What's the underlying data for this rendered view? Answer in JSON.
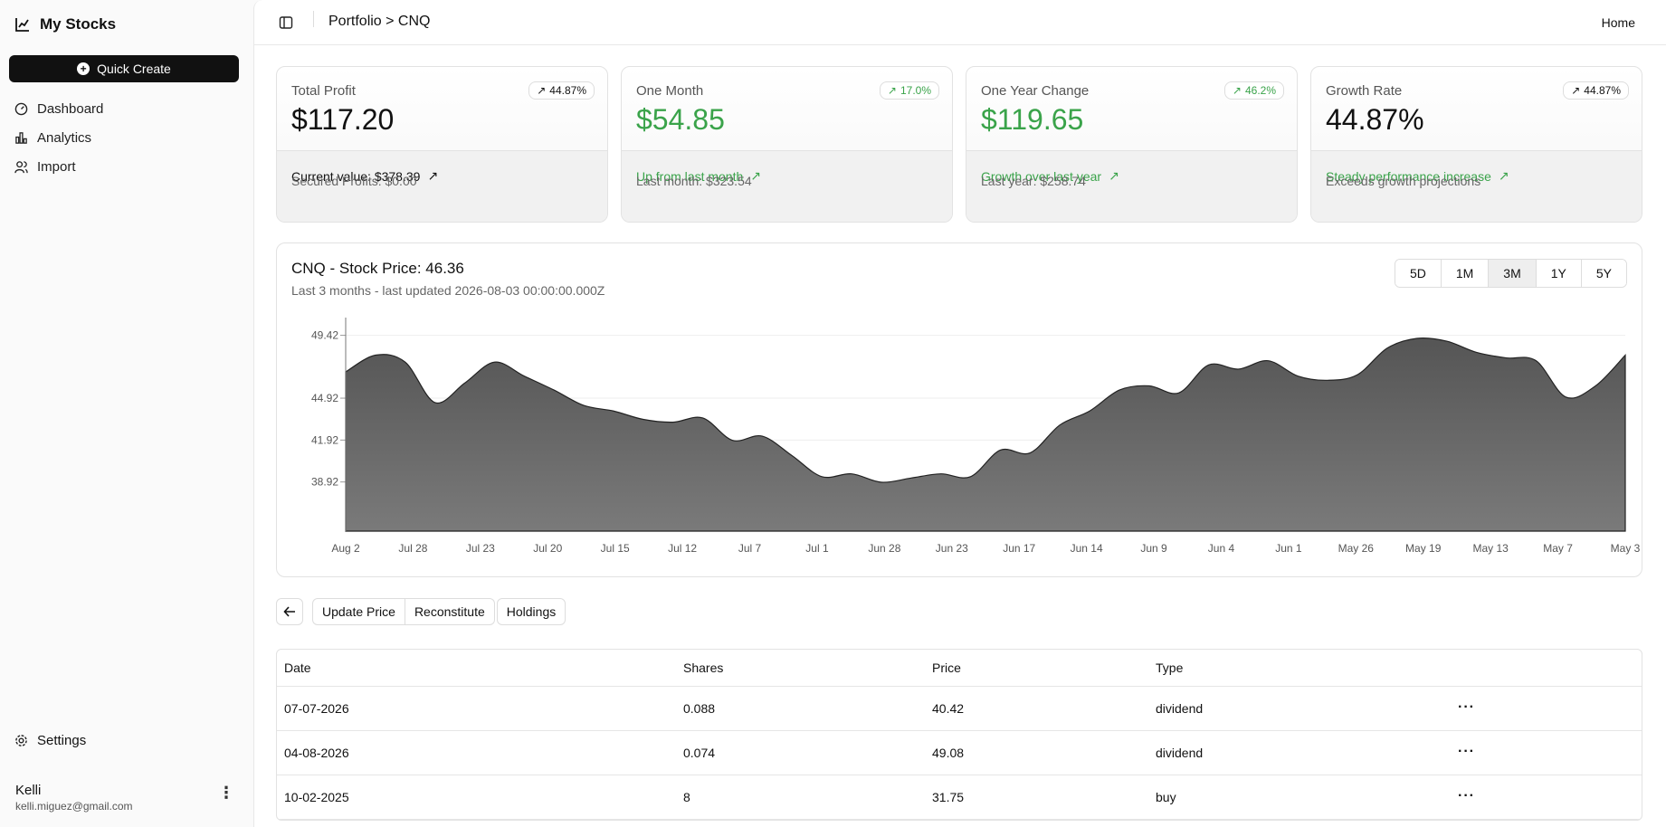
{
  "sidebar": {
    "brand": "My Stocks",
    "quick_create": "Quick Create",
    "nav": [
      {
        "label": "Dashboard",
        "icon": "gauge-icon"
      },
      {
        "label": "Analytics",
        "icon": "bar-chart-icon"
      },
      {
        "label": "Import",
        "icon": "users-icon"
      }
    ],
    "settings": "Settings",
    "user": {
      "name": "Kelli",
      "email": "kelli.miguez@gmail.com"
    }
  },
  "topbar": {
    "breadcrumb": "Portfolio > CNQ",
    "home": "Home"
  },
  "cards": [
    {
      "label": "Total Profit",
      "badge": "44.87%",
      "value": "$117.20",
      "line1": "Current value: $378.39",
      "line2": "Secured Profits: $0.00",
      "accent": false
    },
    {
      "label": "One Month",
      "badge": "17.0%",
      "value": "$54.85",
      "line1": "Up from last month",
      "line2": "Last month: $323.54",
      "accent": true
    },
    {
      "label": "One Year Change",
      "badge": "46.2%",
      "value": "$119.65",
      "line1": "Growth over last year",
      "line2": "Last year: $258.74",
      "accent": true
    },
    {
      "label": "Growth Rate",
      "badge": "44.87%",
      "value": "44.87%",
      "line1": "Steady performance increase",
      "line2": "Exceeds growth projections",
      "accent": false
    }
  ],
  "colors": {
    "accent_green": "#3aa34a"
  },
  "chart": {
    "title": "CNQ - Stock Price: 46.36",
    "subtitle": "Last 3 months - last updated 2026-08-03 00:00:00.000Z",
    "ranges": [
      "5D",
      "1M",
      "3M",
      "1Y",
      "5Y"
    ],
    "active_range": "3M"
  },
  "chart_data": {
    "type": "area",
    "title": "CNQ - Stock Price: 46.36",
    "yticks": [
      49.42,
      44.92,
      41.92,
      38.92
    ],
    "ylim": [
      35.4,
      50.3
    ],
    "xlabels": [
      "Aug 2",
      "Jul 28",
      "Jul 23",
      "Jul 20",
      "Jul 15",
      "Jul 12",
      "Jul 7",
      "Jul 1",
      "Jun 28",
      "Jun 23",
      "Jun 17",
      "Jun 14",
      "Jun 9",
      "Jun 4",
      "Jun 1",
      "May 26",
      "May 19",
      "May 13",
      "May 7",
      "May 3"
    ],
    "values": [
      46.8,
      48.0,
      47.5,
      44.6,
      46.0,
      47.5,
      46.5,
      45.5,
      44.4,
      44.0,
      43.4,
      43.2,
      43.5,
      41.9,
      42.2,
      40.8,
      39.3,
      39.5,
      38.9,
      39.2,
      39.5,
      39.3,
      41.2,
      41.0,
      43.0,
      44.0,
      45.5,
      45.8,
      45.3,
      47.3,
      47.0,
      47.6,
      46.5,
      46.2,
      46.6,
      48.5,
      49.2,
      49.0,
      48.2,
      47.8,
      47.6,
      45.0,
      45.8,
      48.0
    ],
    "grid": true
  },
  "actions": {
    "update_price": "Update Price",
    "reconstitute": "Reconstitute",
    "holdings": "Holdings"
  },
  "table": {
    "headers": [
      "Date",
      "Shares",
      "Price",
      "Type"
    ],
    "rows": [
      {
        "date": "07-07-2026",
        "shares": "0.088",
        "price": "40.42",
        "type": "dividend"
      },
      {
        "date": "04-08-2026",
        "shares": "0.074",
        "price": "49.08",
        "type": "dividend"
      },
      {
        "date": "10-02-2025",
        "shares": "8",
        "price": "31.75",
        "type": "buy"
      }
    ]
  }
}
